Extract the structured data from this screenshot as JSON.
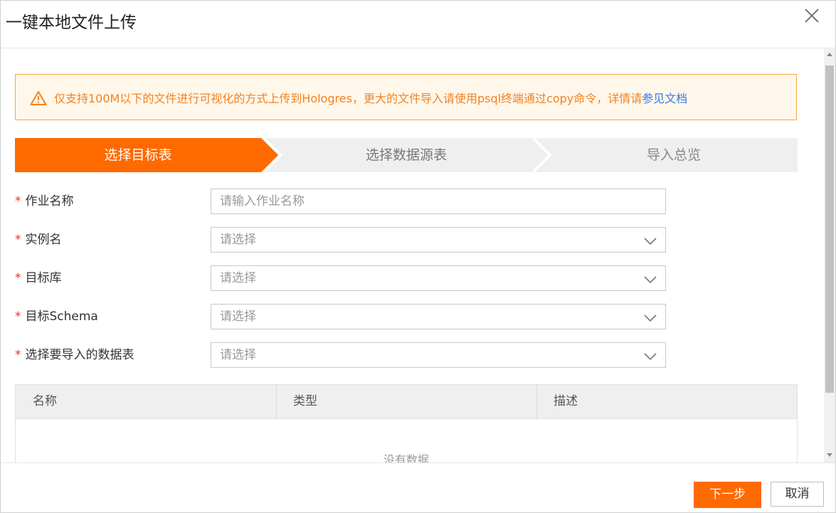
{
  "dialog": {
    "title": "一键本地文件上传"
  },
  "notice": {
    "text": "仅支持100M以下的文件进行可视化的方式上传到Hologres，更大的文件导入请使用psql终端通过copy命令，详情请",
    "link": "参见文档"
  },
  "steps": [
    {
      "label": "选择目标表",
      "active": true
    },
    {
      "label": "选择数据源表",
      "active": false
    },
    {
      "label": "导入总览",
      "active": false
    }
  ],
  "form": {
    "job_name": {
      "label": "作业名称",
      "placeholder": "请输入作业名称"
    },
    "instance": {
      "label": "实例名",
      "placeholder": "请选择"
    },
    "database": {
      "label": "目标库",
      "placeholder": "请选择"
    },
    "schema": {
      "label": "目标Schema",
      "placeholder": "请选择"
    },
    "table": {
      "label": "选择要导入的数据表",
      "placeholder": "请选择"
    }
  },
  "table": {
    "columns": [
      "名称",
      "类型",
      "描述"
    ],
    "empty_text": "没有数据"
  },
  "footer": {
    "next_label": "下一步",
    "cancel_label": "取消"
  },
  "colors": {
    "accent": "#ff6a00",
    "warning": "#f5811f",
    "link": "#3b77e3",
    "required": "#e5322d"
  },
  "icons": {
    "close": "close-icon",
    "warning": "warning-icon",
    "chevron": "chevron-down-icon"
  }
}
